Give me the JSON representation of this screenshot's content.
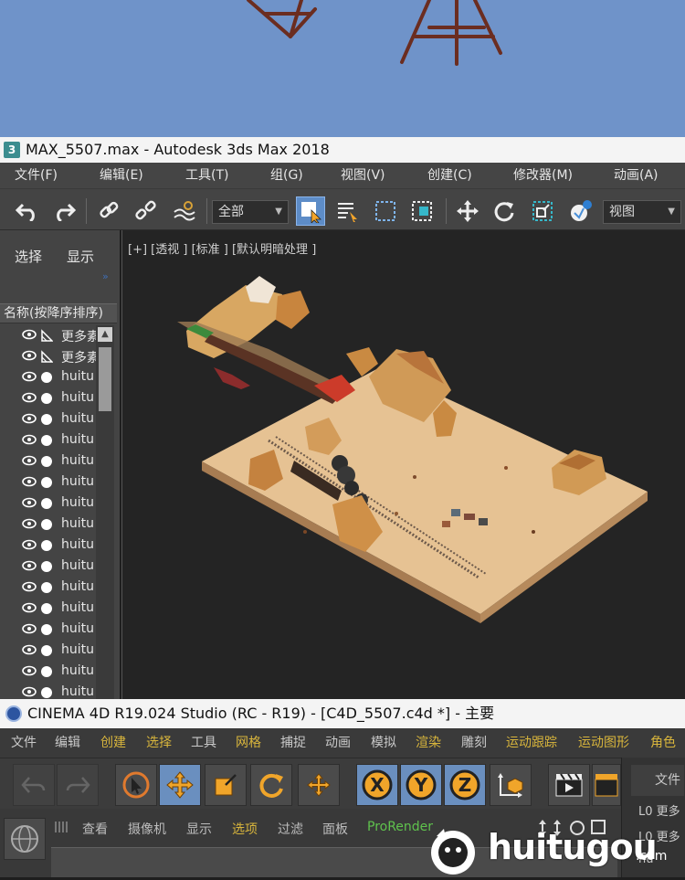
{
  "max": {
    "title": "MAX_5507.max - Autodesk 3ds Max 2018",
    "app_icon_text": "3",
    "menu": [
      "文件(F)",
      "编辑(E)",
      "工具(T)",
      "组(G)",
      "视图(V)",
      "创建(C)",
      "修改器(M)",
      "动画(A)"
    ],
    "toolbar": {
      "selection_filter": "全部",
      "ref_coord": "视图"
    },
    "panel": {
      "tabs": [
        "选择",
        "显示"
      ],
      "column_header": "名称(按降序排序)",
      "rows": [
        {
          "kind": "layer",
          "name": "更多素"
        },
        {
          "kind": "layer",
          "name": "更多素"
        },
        {
          "kind": "object",
          "name": "huitu"
        },
        {
          "kind": "object",
          "name": "huitu"
        },
        {
          "kind": "object",
          "name": "huitu"
        },
        {
          "kind": "object",
          "name": "huitu"
        },
        {
          "kind": "object",
          "name": "huitu"
        },
        {
          "kind": "object",
          "name": "huitu"
        },
        {
          "kind": "object",
          "name": "huitu"
        },
        {
          "kind": "object",
          "name": "huitu"
        },
        {
          "kind": "object",
          "name": "huitu"
        },
        {
          "kind": "object",
          "name": "huitu"
        },
        {
          "kind": "object",
          "name": "huitu"
        },
        {
          "kind": "object",
          "name": "huitu"
        },
        {
          "kind": "object",
          "name": "huitu"
        },
        {
          "kind": "object",
          "name": "huitu"
        },
        {
          "kind": "object",
          "name": "huitu"
        },
        {
          "kind": "object",
          "name": "huitu"
        }
      ]
    },
    "viewport_label": "[+] [透视 ] [标准 ] [默认明暗处理 ]"
  },
  "c4d": {
    "title": "CINEMA 4D R19.024 Studio (RC - R19) - [C4D_5507.c4d *] - 主要",
    "menu": [
      {
        "label": "文件",
        "hl": false
      },
      {
        "label": "编辑",
        "hl": false
      },
      {
        "label": "创建",
        "hl": true
      },
      {
        "label": "选择",
        "hl": true
      },
      {
        "label": "工具",
        "hl": false
      },
      {
        "label": "网格",
        "hl": true
      },
      {
        "label": "捕捉",
        "hl": false
      },
      {
        "label": "动画",
        "hl": false
      },
      {
        "label": "模拟",
        "hl": false
      },
      {
        "label": "渲染",
        "hl": true
      },
      {
        "label": "雕刻",
        "hl": false
      },
      {
        "label": "运动跟踪",
        "hl": true
      },
      {
        "label": "运动图形",
        "hl": true
      },
      {
        "label": "角色",
        "hl": true
      }
    ],
    "view_tabs": [
      {
        "label": "查看",
        "style": "normal"
      },
      {
        "label": "摄像机",
        "style": "normal"
      },
      {
        "label": "显示",
        "style": "normal"
      },
      {
        "label": "选项",
        "style": "hl"
      },
      {
        "label": "过滤",
        "style": "normal"
      },
      {
        "label": "面板",
        "style": "normal"
      },
      {
        "label": "ProRender",
        "style": "green"
      }
    ],
    "axis_buttons": [
      "X",
      "Y",
      "Z"
    ],
    "right_panel": {
      "file_label": "文件",
      "objects": [
        "L0 更多",
        "L0 更多",
        "hu"
      ]
    }
  },
  "watermark": {
    "text": "huitugou",
    "suffix": ".com"
  },
  "colors": {
    "sky": "#6f93c9",
    "max_active": "#5d8cc7",
    "c4d_highlight": "#d8b53c",
    "c4d_green": "#5fc24d"
  }
}
